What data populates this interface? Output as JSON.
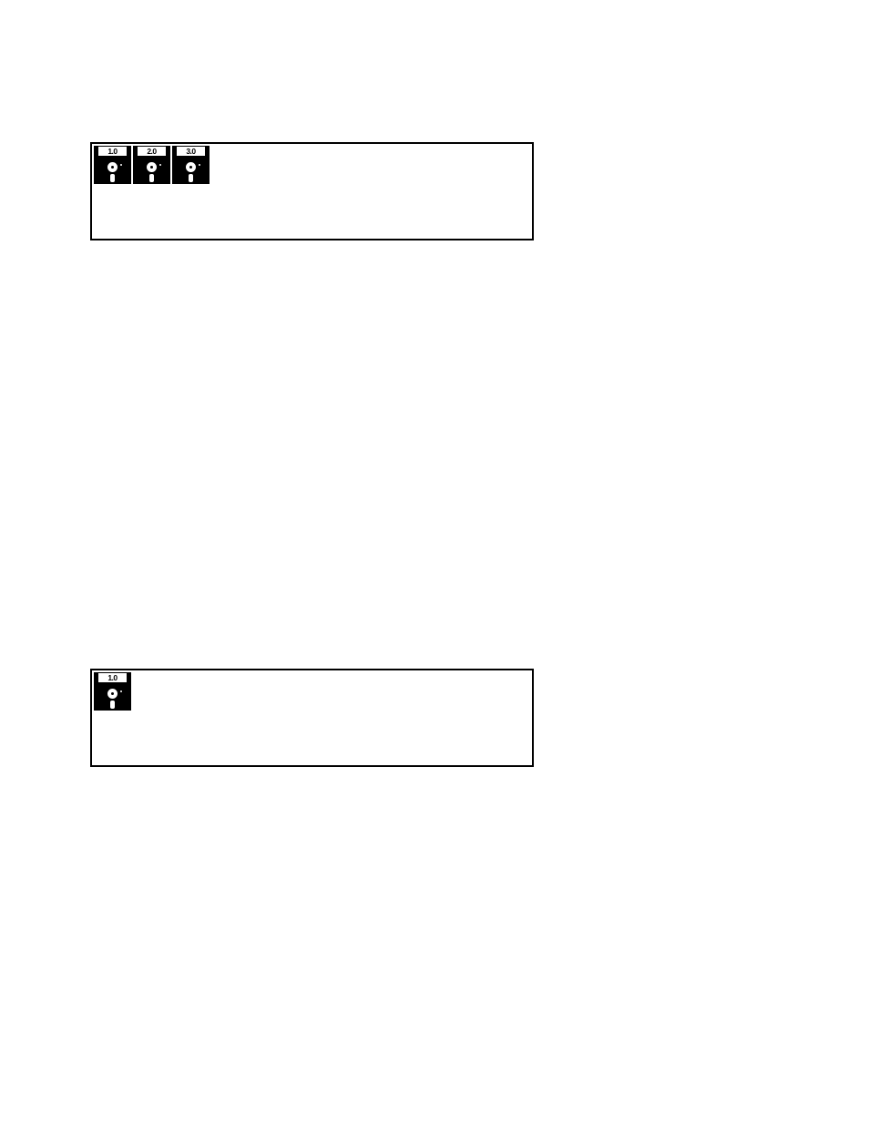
{
  "panel1": {
    "disks": [
      {
        "label": "1.0"
      },
      {
        "label": "2.0"
      },
      {
        "label": "3.0"
      }
    ]
  },
  "panel2": {
    "disks": [
      {
        "label": "1.0"
      }
    ]
  }
}
